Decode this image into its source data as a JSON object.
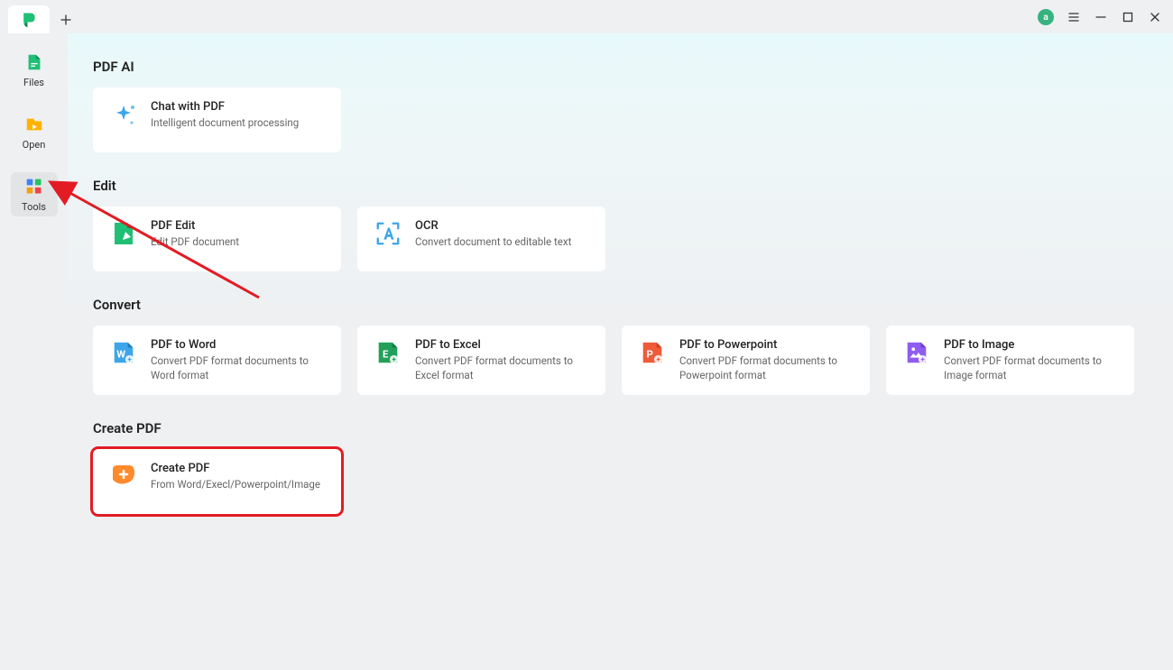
{
  "sidebar": {
    "items": [
      {
        "label": "Files"
      },
      {
        "label": "Open"
      },
      {
        "label": "Tools"
      }
    ]
  },
  "sections": {
    "pdf_ai": {
      "title": "PDF AI",
      "cards": {
        "chat": {
          "title": "Chat with PDF",
          "desc": "Intelligent document processing"
        }
      }
    },
    "edit": {
      "title": "Edit",
      "cards": {
        "edit": {
          "title": "PDF Edit",
          "desc": "Edit PDF document"
        },
        "ocr": {
          "title": "OCR",
          "desc": "Convert document to editable text"
        }
      }
    },
    "convert": {
      "title": "Convert",
      "cards": {
        "word": {
          "title": "PDF to Word",
          "desc": "Convert PDF format documents to Word format"
        },
        "excel": {
          "title": "PDF to Excel",
          "desc": "Convert PDF format documents to Excel format"
        },
        "ppt": {
          "title": "PDF to Powerpoint",
          "desc": "Convert PDF format documents to Powerpoint format"
        },
        "image": {
          "title": "PDF to Image",
          "desc": "Convert PDF format documents to Image format"
        }
      }
    },
    "create": {
      "title": "Create PDF",
      "cards": {
        "create": {
          "title": "Create PDF",
          "desc": "From Word/Execl/Powerpoint/Image"
        }
      }
    }
  },
  "avatar_initial": "a"
}
